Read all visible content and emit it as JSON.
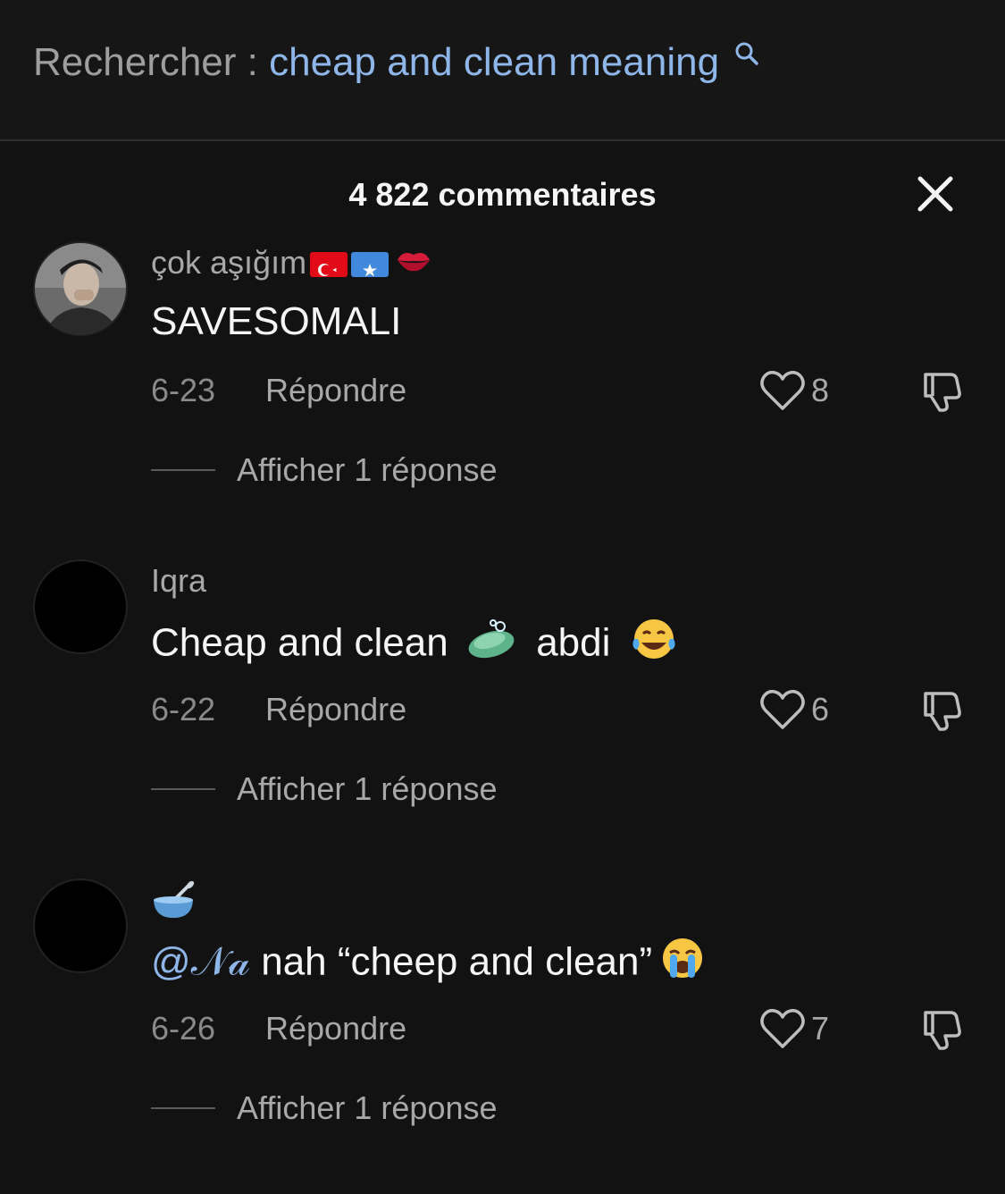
{
  "search": {
    "prefix": "Rechercher :",
    "query": "cheap and clean meaning"
  },
  "header": {
    "title": "4 822 commentaires"
  },
  "comments": [
    {
      "username": "çok aşığım",
      "username_emojis": [
        "turkey-flag",
        "somalia-flag",
        "kiss-mark"
      ],
      "text": "SAVESOMALI",
      "date": "6-23",
      "reply_label": "Répondre",
      "likes": "8",
      "view_replies": "Afficher 1 réponse",
      "avatar": "photo"
    },
    {
      "username": "Iqra",
      "text_before": "Cheap and clean",
      "text_after": "abdi",
      "emojis": [
        "soap-emoji",
        "tears-of-joy-emoji"
      ],
      "date": "6-22",
      "reply_label": "Répondre",
      "likes": "6",
      "view_replies": "Afficher 1 réponse",
      "avatar": "black"
    },
    {
      "username_emoji": "bowl-with-spoon-emoji",
      "mention": "@𝒩𝒶",
      "text": "nah “cheep and clean”",
      "emojis": [
        "loudly-crying-emoji"
      ],
      "date": "6-26",
      "reply_label": "Répondre",
      "likes": "7",
      "view_replies": "Afficher 1 réponse",
      "avatar": "black"
    }
  ],
  "colors": {
    "background": "#121212",
    "accent_link": "#8fb6e8",
    "text_primary": "#f5f5f5",
    "text_secondary": "#a8a8a8"
  }
}
